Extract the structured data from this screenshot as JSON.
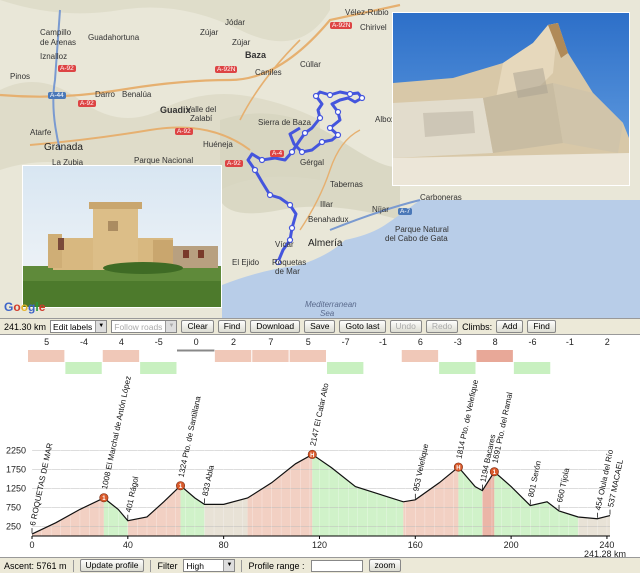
{
  "map": {
    "labels": [
      {
        "text": "Campillo",
        "pos": "a1"
      },
      {
        "text": "de Arenas",
        "pos": "a2"
      },
      {
        "text": "Guadahortuna",
        "pos": "a3"
      },
      {
        "text": "Jódar",
        "pos": "a4"
      },
      {
        "text": "Zújar",
        "pos": "a5"
      },
      {
        "text": "Chirivel",
        "pos": "a6"
      },
      {
        "text": "Vélez-Rubio",
        "pos": "a7"
      },
      {
        "text": "Baza",
        "pos": "a8"
      },
      {
        "text": "Caniles",
        "pos": "a9"
      },
      {
        "text": "Darro",
        "pos": "a10"
      },
      {
        "text": "Benalúa",
        "pos": "a11"
      },
      {
        "text": "Guadix",
        "pos": "a12"
      },
      {
        "text": "Valle del",
        "pos": "a13"
      },
      {
        "text": "Zalabí",
        "pos": "a14"
      },
      {
        "text": "Atarfe",
        "pos": "a15"
      },
      {
        "text": "Granada",
        "pos": "a16"
      },
      {
        "text": "La Zubia",
        "pos": "a17"
      },
      {
        "text": "Parque Nacional",
        "pos": "a18"
      },
      {
        "text": "Huéneja",
        "pos": "a19"
      },
      {
        "text": "Gérgal",
        "pos": "a20"
      },
      {
        "text": "Tabernas",
        "pos": "a21"
      },
      {
        "text": "Níjar",
        "pos": "a22"
      },
      {
        "text": "Carboneras",
        "pos": "a23"
      },
      {
        "text": "Benahadux",
        "pos": "a24"
      },
      {
        "text": "Almería",
        "pos": "a25"
      },
      {
        "text": "Vícar",
        "pos": "a26"
      },
      {
        "text": "El Ejido",
        "pos": "a27"
      },
      {
        "text": "Roquetas",
        "pos": "a28"
      },
      {
        "text": "de Mar",
        "pos": "a29"
      },
      {
        "text": "Parque Natural",
        "pos": "a30"
      },
      {
        "text": "del Cabo de Gata",
        "pos": "a31"
      },
      {
        "text": "Mediterranean",
        "pos": "a32"
      },
      {
        "text": "Sea",
        "pos": "a33"
      },
      {
        "text": "Albox",
        "pos": "a34"
      },
      {
        "text": "Zújar",
        "pos": "a35"
      },
      {
        "text": "Sierra de Baza",
        "pos": "a36"
      },
      {
        "text": "Cúllar",
        "pos": "a37"
      },
      {
        "text": "Illar",
        "pos": "a38"
      },
      {
        "text": "Iznalloz",
        "pos": "a39"
      },
      {
        "text": "Pinos",
        "pos": "a40"
      }
    ],
    "roads": [
      {
        "text": "A-92N",
        "pos": "r1",
        "color": "red"
      },
      {
        "text": "A-92N",
        "pos": "r2",
        "color": "red"
      },
      {
        "text": "A-44",
        "pos": "r3",
        "color": "blue"
      },
      {
        "text": "A-92",
        "pos": "r4",
        "color": "red"
      },
      {
        "text": "A-92",
        "pos": "r5",
        "color": "red"
      },
      {
        "text": "A-92",
        "pos": "r6",
        "color": "red"
      },
      {
        "text": "A-7",
        "pos": "r7",
        "color": "blue"
      },
      {
        "text": "A-4",
        "pos": "r8",
        "color": "red"
      },
      {
        "text": "A-92",
        "pos": "r9",
        "color": "red"
      }
    ],
    "logo": {
      "letters": [
        "G",
        "o",
        "o",
        "g",
        "l",
        "e"
      ]
    },
    "colors": {
      "route": "#4455dd",
      "waypoint": "#ffffff",
      "sea": "#b8cde8",
      "land": "#e9e7d8"
    }
  },
  "toolbar": {
    "distance": "241.30 km",
    "edit_labels": "Edit labels",
    "follow_roads": "Follow roads",
    "clear": "Clear",
    "find": "Find",
    "download": "Download",
    "save": "Save",
    "goto_last": "Goto last",
    "undo": "Undo",
    "redo": "Redo",
    "climbs_label": "Climbs:",
    "add": "Add",
    "find2": "Find"
  },
  "profile": {
    "gradients": [
      "5",
      "-4",
      "4",
      "-5",
      "0",
      "2",
      "7",
      "5",
      "-7",
      "-1",
      "6",
      "-3",
      "8",
      "-6",
      "-1",
      "2"
    ],
    "ylabels": [
      "2250",
      "1750",
      "1250",
      "750",
      "250"
    ],
    "yticks": [
      2250,
      1750,
      1250,
      750,
      250
    ],
    "xlabels": [
      "0",
      "40",
      "80",
      "120",
      "160",
      "200",
      "240"
    ],
    "xticks": [
      0,
      40,
      80,
      120,
      160,
      200,
      240
    ],
    "total_km": "241.28 km",
    "ymin": 0,
    "ymax": 2500,
    "xmax": 241.28,
    "points": [
      {
        "x": 0,
        "y": 50
      },
      {
        "x": 10,
        "y": 350
      },
      {
        "x": 20,
        "y": 700
      },
      {
        "x": 30,
        "y": 1000
      },
      {
        "x": 36,
        "y": 700
      },
      {
        "x": 40,
        "y": 401
      },
      {
        "x": 48,
        "y": 500
      },
      {
        "x": 55,
        "y": 900
      },
      {
        "x": 62,
        "y": 1324
      },
      {
        "x": 68,
        "y": 1000
      },
      {
        "x": 72,
        "y": 833
      },
      {
        "x": 80,
        "y": 833
      },
      {
        "x": 90,
        "y": 1000
      },
      {
        "x": 100,
        "y": 1400
      },
      {
        "x": 110,
        "y": 1900
      },
      {
        "x": 117,
        "y": 2147
      },
      {
        "x": 125,
        "y": 1800
      },
      {
        "x": 135,
        "y": 1300
      },
      {
        "x": 145,
        "y": 1100
      },
      {
        "x": 155,
        "y": 900
      },
      {
        "x": 160,
        "y": 953
      },
      {
        "x": 170,
        "y": 1400
      },
      {
        "x": 178,
        "y": 1814
      },
      {
        "x": 185,
        "y": 1300
      },
      {
        "x": 188,
        "y": 1194
      },
      {
        "x": 193,
        "y": 1691
      },
      {
        "x": 200,
        "y": 1300
      },
      {
        "x": 208,
        "y": 801
      },
      {
        "x": 215,
        "y": 900
      },
      {
        "x": 220,
        "y": 660
      },
      {
        "x": 228,
        "y": 500
      },
      {
        "x": 236,
        "y": 454
      },
      {
        "x": 241.28,
        "y": 537
      }
    ],
    "bands": [
      {
        "from": 0,
        "to": 30,
        "type": "up"
      },
      {
        "from": 30,
        "to": 40,
        "type": "down"
      },
      {
        "from": 40,
        "to": 62,
        "type": "up"
      },
      {
        "from": 62,
        "to": 72,
        "type": "down"
      },
      {
        "from": 72,
        "to": 90,
        "type": "flat"
      },
      {
        "from": 90,
        "to": 100,
        "type": "up"
      },
      {
        "from": 100,
        "to": 117,
        "type": "up"
      },
      {
        "from": 117,
        "to": 155,
        "type": "down"
      },
      {
        "from": 155,
        "to": 178,
        "type": "up"
      },
      {
        "from": 178,
        "to": 188,
        "type": "down"
      },
      {
        "from": 188,
        "to": 193,
        "type": "steep"
      },
      {
        "from": 193,
        "to": 208,
        "type": "down"
      },
      {
        "from": 208,
        "to": 228,
        "type": "down"
      },
      {
        "from": 228,
        "to": 241.28,
        "type": "flat"
      }
    ],
    "labels": [
      {
        "text": "6 ROQUETAS DE MAR",
        "x": 0,
        "y": 50
      },
      {
        "text": "1008 El Marchal de Antón López",
        "x": 30,
        "y": 1008,
        "climb": "1"
      },
      {
        "text": "401 Rágol",
        "x": 40,
        "y": 401
      },
      {
        "text": "1324 Pto. de Santillana",
        "x": 62,
        "y": 1324,
        "climb": "1"
      },
      {
        "text": "833 Abla",
        "x": 72,
        "y": 833
      },
      {
        "text": "2147 El Calar Alto",
        "x": 117,
        "y": 2147,
        "climb": "H"
      },
      {
        "text": "953 Velefique",
        "x": 160,
        "y": 953
      },
      {
        "text": "1814 Pto. de Velefique",
        "x": 178,
        "y": 1814,
        "climb": "H"
      },
      {
        "text": "1194 Bacares",
        "x": 188,
        "y": 1194
      },
      {
        "text": "1691 Pto. del Ramal",
        "x": 193,
        "y": 1691,
        "climb": "1"
      },
      {
        "text": "801 Serón",
        "x": 208,
        "y": 801
      },
      {
        "text": "660 Tíjola",
        "x": 220,
        "y": 660
      },
      {
        "text": "454 Olula del Río",
        "x": 236,
        "y": 454
      },
      {
        "text": "537 MACAEL",
        "x": 241.28,
        "y": 537
      }
    ],
    "colors": {
      "up": "#f0c8b8",
      "down": "#c8f0c0",
      "flat": "#e4ddcf",
      "steep": "#e8a898",
      "line": "#111111",
      "grid": "#bbbbbb",
      "marker": "#d95a2b"
    }
  },
  "bottombar": {
    "ascent": "Ascent: 5761 m",
    "update_profile": "Update profile",
    "filter_label": "Filter",
    "filter_value": "High",
    "profile_range": "Profile range :",
    "zoom": "zoom"
  }
}
